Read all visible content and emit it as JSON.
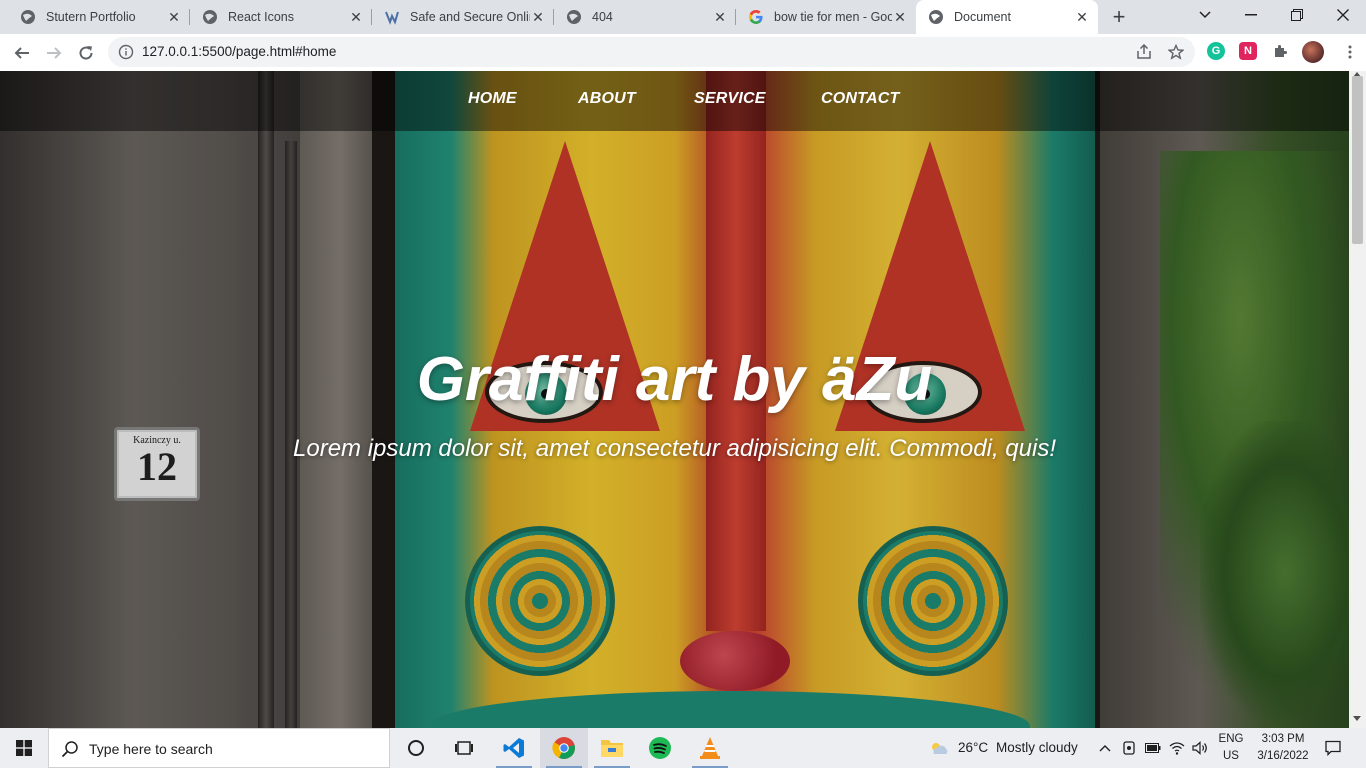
{
  "browser": {
    "tabs": [
      {
        "title": "Stutern Portfolio",
        "favicon": "globe-icon",
        "active": false
      },
      {
        "title": "React Icons",
        "favicon": "globe-icon",
        "active": false
      },
      {
        "title": "Safe and Secure Onlin",
        "favicon": "site-logo-icon",
        "active": false
      },
      {
        "title": "404",
        "favicon": "globe-icon",
        "active": false
      },
      {
        "title": "bow tie for men - Goo",
        "favicon": "google-icon",
        "active": false
      },
      {
        "title": "Document",
        "favicon": "globe-icon",
        "active": true
      }
    ],
    "new_tab_label": "+",
    "url": "127.0.0.1:5500/page.html#home",
    "extensions": [
      {
        "name": "grammarly",
        "letter": "G",
        "color": "#15c39a"
      },
      {
        "name": "notion-web-clipper",
        "letter": "N",
        "color": "#e0245e"
      }
    ]
  },
  "page": {
    "nav": {
      "items": [
        "HOME",
        "ABOUT",
        "SERVICE",
        "CONTACT"
      ]
    },
    "hero": {
      "title": "Graffiti art by äZu",
      "subtitle": "Lorem ipsum dolor sit, amet consectetur adipisicing elit. Commodi, quis!"
    },
    "plaque": {
      "street": "Kazinczy u.",
      "number": "12"
    }
  },
  "taskbar": {
    "search_placeholder": "Type here to search",
    "weather": {
      "temp": "26°C",
      "condition": "Mostly cloudy"
    },
    "language": {
      "lang": "ENG",
      "region": "US"
    },
    "clock": {
      "time": "3:03 PM",
      "date": "3/16/2022"
    },
    "pinned": [
      "task-view-icon",
      "vscode-icon",
      "chrome-icon",
      "file-explorer-icon",
      "spotify-icon",
      "vlc-icon"
    ]
  },
  "colors": {
    "accent": "#1a73e8",
    "nav_bg": "rgba(0,0,0,0.45)",
    "taskbar": "#eceef2"
  }
}
